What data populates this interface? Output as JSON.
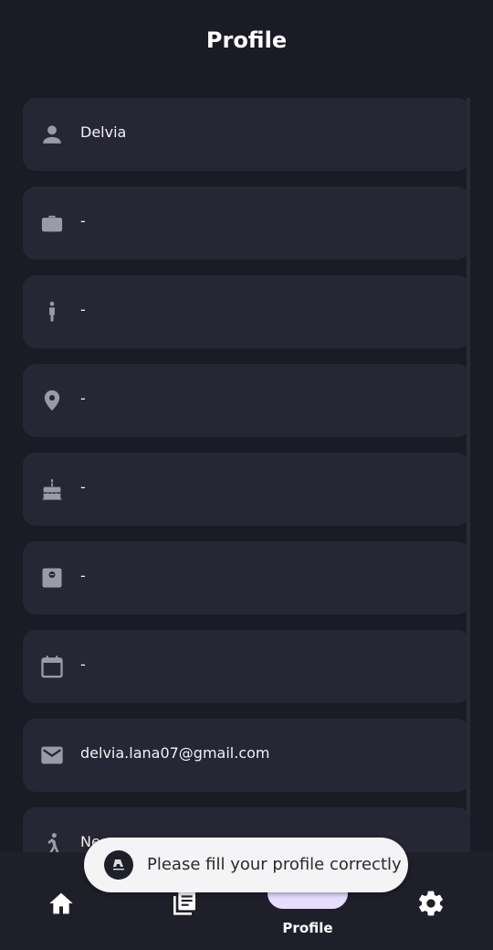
{
  "header": {
    "title": "Profile"
  },
  "profile_fields": [
    {
      "icon": "person-icon",
      "value": "Delvia"
    },
    {
      "icon": "briefcase-icon",
      "value": "-"
    },
    {
      "icon": "standing-person-icon",
      "value": "-"
    },
    {
      "icon": "location-pin-icon",
      "value": "-"
    },
    {
      "icon": "birthday-cake-icon",
      "value": "-"
    },
    {
      "icon": "weight-scale-icon",
      "value": "-"
    },
    {
      "icon": "calendar-icon",
      "value": "-"
    },
    {
      "icon": "email-icon",
      "value": "delvia.lana07@gmail.com"
    },
    {
      "icon": "exercise-icon",
      "value": "Ne..."
    }
  ],
  "bottom_nav": {
    "items": [
      {
        "icon": "home-icon"
      },
      {
        "icon": "articles-icon"
      },
      {
        "icon": "profile-icon",
        "label": "Profile",
        "active": true
      },
      {
        "icon": "settings-icon"
      }
    ]
  },
  "toast": {
    "message": "Please fill your profile correctly"
  },
  "colors": {
    "background": "#1b1b25",
    "card": "#262634",
    "icon": "#9a9aa8",
    "active_pill": "#e6ddff"
  }
}
